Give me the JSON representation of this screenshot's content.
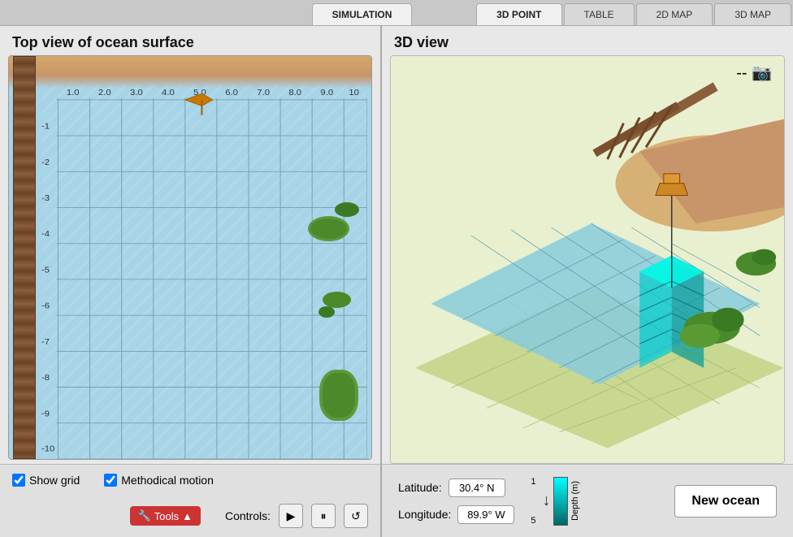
{
  "tabs": [
    {
      "id": "simulation",
      "label": "SIMULATION",
      "active": true
    },
    {
      "id": "3dpoint",
      "label": "3D POINT",
      "active": false
    },
    {
      "id": "table",
      "label": "TABLE",
      "active": false
    },
    {
      "id": "2dmap",
      "label": "2D MAP",
      "active": false
    },
    {
      "id": "3dmap",
      "label": "3D MAP",
      "active": false
    }
  ],
  "left_panel": {
    "title": "Top view of ocean surface",
    "show_grid_label": "Show grid",
    "methodical_motion_label": "Methodical motion",
    "show_grid_checked": true,
    "methodical_motion_checked": true,
    "controls_label": "Controls:",
    "grid_x_labels": [
      "1.0",
      "2.0",
      "3.0",
      "4.0",
      "5.0",
      "6.0",
      "7.0",
      "8.0",
      "9.0",
      "10"
    ],
    "grid_y_labels": [
      "-1",
      "-2",
      "-3",
      "-4",
      "-5",
      "-6",
      "-7",
      "-8",
      "-9",
      "-10"
    ]
  },
  "right_panel": {
    "title": "3D view",
    "latitude_label": "Latitude:",
    "latitude_value": "30.4° N",
    "longitude_label": "Longitude:",
    "longitude_value": "89.9° W",
    "depth_top": "1",
    "depth_bottom": "5",
    "depth_unit": "Depth (m)",
    "new_ocean_label": "New ocean"
  },
  "tools": {
    "label": "Tools"
  },
  "icons": {
    "play": "▶",
    "pause": "⏸",
    "reset": "↺",
    "camera": "📷",
    "tools_icon": "🔧"
  },
  "colors": {
    "ocean_water": "#a8d4e8",
    "sand": "#d4a96a",
    "grid_line": "#6699aa",
    "ocean_3d_top": "#88ccdd",
    "depth_shallow": "#00ffee",
    "depth_deep": "#006677",
    "iso_ground": "#c8d890"
  }
}
